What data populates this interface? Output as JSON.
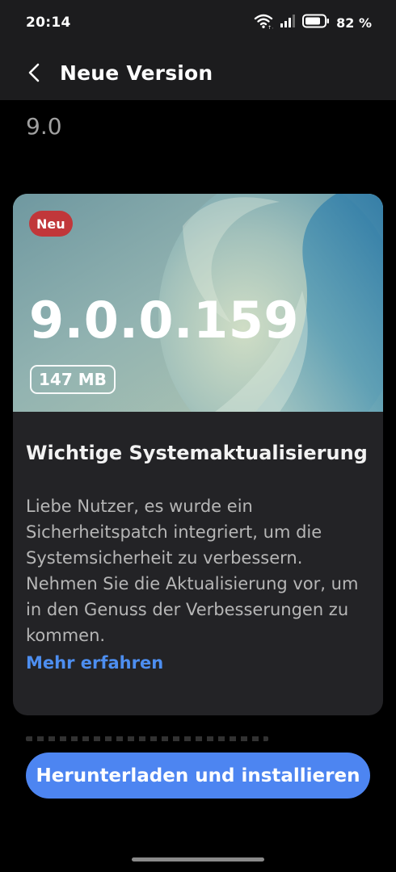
{
  "status_bar": {
    "time": "20:14",
    "battery_text": "82 %",
    "battery_level_percent": 82
  },
  "header": {
    "title": "Neue Version"
  },
  "version_short": "9.0",
  "card": {
    "badge": "Neu",
    "version": "9.0.0.159",
    "size": "147 MB",
    "title": "Wichtige Systemaktualisierung",
    "description": "Liebe Nutzer, es wurde ein Sicherheitspatch integriert, um die Systemsicherheit zu verbessern. Nehmen Sie die Aktualisierung vor, um in den Genuss der Verbesserungen zu kommen.",
    "learn_more": "Mehr erfahren"
  },
  "action": {
    "label": "Herunterladen und installieren"
  },
  "colors": {
    "accent": "#4d85f1",
    "link": "#4d8ef0",
    "badge_red": "#c1373a",
    "background": "#000000",
    "card": "#232326"
  },
  "icons": [
    "chevron-left-icon",
    "wifi-icon",
    "signal-icon",
    "battery-icon"
  ]
}
